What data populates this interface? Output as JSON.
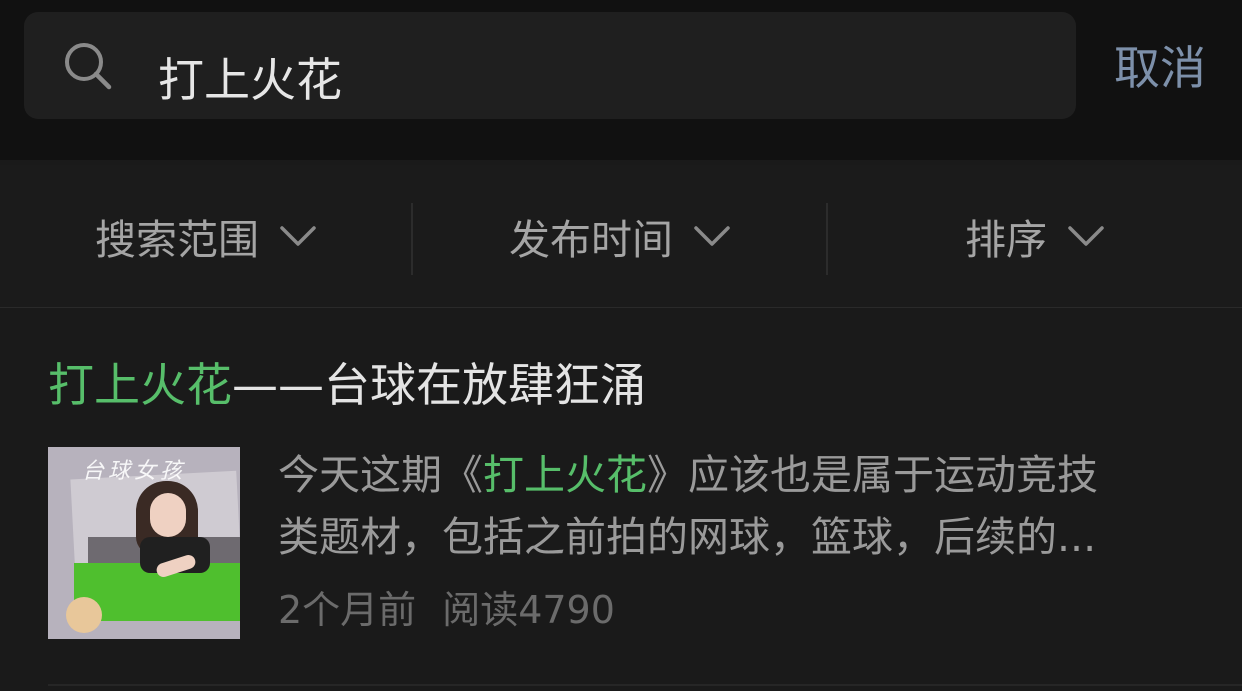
{
  "search": {
    "query": "打上火花",
    "cancel_label": "取消"
  },
  "filters": [
    {
      "label": "搜索范围"
    },
    {
      "label": "发布时间"
    },
    {
      "label": "排序"
    }
  ],
  "result": {
    "title_highlight": "打上火花",
    "title_rest": "——台球在放肆狂涌",
    "thumbnail_caption": "台球女孩",
    "desc_line1_pre": "今天这期《",
    "desc_line1_highlight": "打上火花",
    "desc_line1_post": "》应该也是属于运动竞技",
    "desc_line2": "类题材，包括之前拍的网球，篮球，后续的...",
    "time": "2个月前",
    "reads": "阅读4790"
  },
  "colors": {
    "highlight": "#57be6a",
    "cancel": "#7d90aa",
    "background": "#1a1a1a"
  }
}
